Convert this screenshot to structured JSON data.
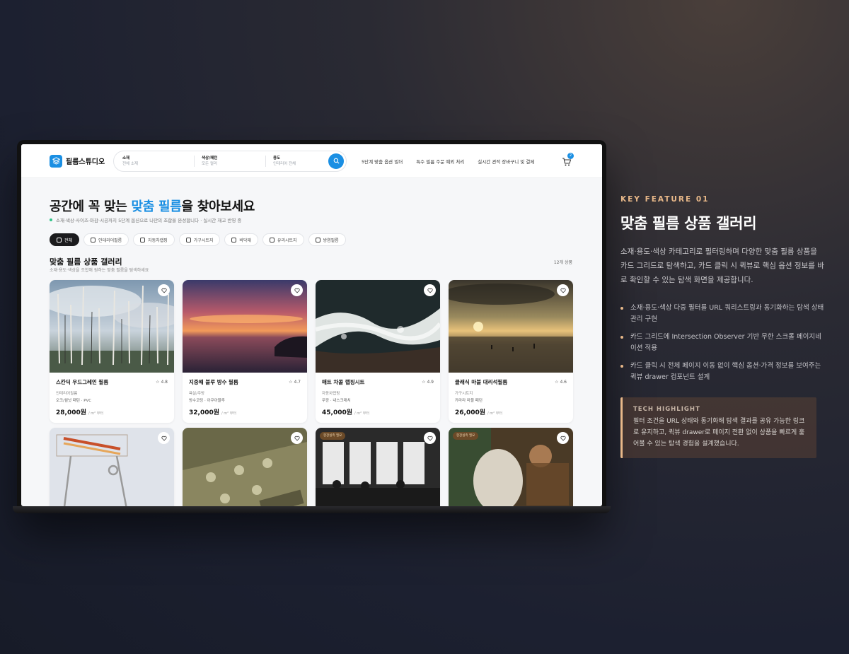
{
  "nav": {
    "brand": "필름스튜디오",
    "search": [
      {
        "label": "소재",
        "value": "전체 소재"
      },
      {
        "label": "색상/패턴",
        "value": "모든 컬러"
      },
      {
        "label": "용도",
        "value": "인테리어 전체"
      }
    ],
    "links": [
      "5단계 맞춤 옵션 빌더",
      "특수 필름 주문 예외 처리",
      "실시간 견적 장바구니 및 결제"
    ],
    "cart_count": "2"
  },
  "hero": {
    "title_before": "공간에 꼭 맞는 ",
    "title_accent": "맞춤 필름",
    "title_after": "을 찾아보세요",
    "subtitle": "소재·색상·사이즈·마감·시공까지 5단계 옵션으로 나만의 조합을 완성합니다 · 실시간 재고 반영 중"
  },
  "chips": [
    "전체",
    "인테리어필름",
    "자동차랩핑",
    "가구시트지",
    "바닥재",
    "유리시트지",
    "방염필름"
  ],
  "gallery": {
    "title": "맞춤 필름 상품 갤러리",
    "subtitle": "소재·용도·색상을 조합해 원하는 맞춤 필름을 탐색하세요",
    "count": "12개 상품",
    "price_unit": "/ m² 부터",
    "cards": [
      {
        "name": "스칸딕 우드그레인 필름",
        "rating": "4.8",
        "category": "인테리어필름",
        "spec": "오크/월넛 패턴 · PVC",
        "price": "28,000원"
      },
      {
        "name": "지중해 블루 방수 필름",
        "rating": "4.7",
        "category": "욕실/주방",
        "spec": "방수코팅 · 아쿠아블루",
        "price": "32,000원"
      },
      {
        "name": "매트 차콜 랩핑시트",
        "rating": "4.9",
        "category": "자동차랩핑",
        "spec": "무광 · 내스크래치",
        "price": "45,000원"
      },
      {
        "name": "클래식 마블 대리석필름",
        "rating": "4.6",
        "category": "가구시트지",
        "spec": "카라라 마블 패턴",
        "price": "26,000원"
      },
      {
        "tag": ""
      },
      {
        "tag": ""
      },
      {
        "tag": "현장실측 필요"
      },
      {
        "tag": "현장실측 필요"
      }
    ]
  },
  "panel": {
    "eyebrow": "KEY FEATURE 01",
    "title": "맞춤 필름 상품 갤러리",
    "description": "소재·용도·색상 카테고리로 필터링하며 다양한 맞춤 필름 상품을 카드 그리드로 탐색하고, 카드 클릭 시 퀵뷰로 핵심 옵션 정보를 바로 확인할 수 있는 탐색 화면을 제공합니다.",
    "bullets": [
      "소재·용도·색상 다중 필터를 URL 쿼리스트링과 동기화하는 탐색 상태 관리 구현",
      "카드 그리드에 Intersection Observer 기반 무한 스크롤 페이지네이션 적용",
      "카드 클릭 시 전체 페이지 이동 없이 핵심 옵션·가격 정보를 보여주는 퀵뷰 drawer 컴포넌트 설계"
    ],
    "tech_label": "TECH HIGHLIGHT",
    "tech_text": "필터 조건을 URL 상태와 동기화해 탐색 결과를 공유 가능한 링크로 유지하고, 퀵뷰 drawer로 페이지 전환 없이 상품을 빠르게 훑어볼 수 있는 탐색 경험을 설계했습니다."
  },
  "colors": {
    "accent": "#1a8fe3",
    "highlight": "#e8b889"
  }
}
